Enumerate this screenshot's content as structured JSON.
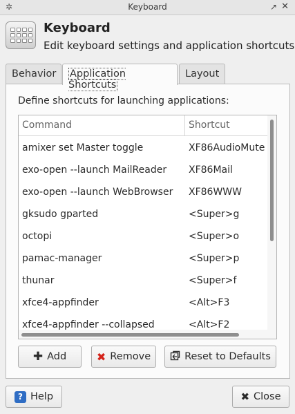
{
  "window": {
    "title": "Keyboard",
    "menu_icon": "✲",
    "maximize_icon": "↗",
    "close_icon": "✕"
  },
  "header": {
    "title": "Keyboard",
    "subtitle": "Edit keyboard settings and application shortcuts",
    "icon": "keyboard-icon"
  },
  "tabs": [
    {
      "label": "Behavior",
      "active": false
    },
    {
      "label": "Application Shortcuts",
      "active": true
    },
    {
      "label": "Layout",
      "active": false
    }
  ],
  "shortcuts": {
    "instruction": "Define shortcuts for launching applications:",
    "columns": {
      "command": "Command",
      "shortcut": "Shortcut"
    },
    "rows": [
      {
        "command": "amixer set Master toggle",
        "shortcut": "XF86AudioMute"
      },
      {
        "command": "exo-open --launch MailReader",
        "shortcut": "XF86Mail"
      },
      {
        "command": "exo-open --launch WebBrowser",
        "shortcut": "XF86WWW"
      },
      {
        "command": "gksudo gparted",
        "shortcut": "<Super>g"
      },
      {
        "command": "octopi",
        "shortcut": "<Super>o"
      },
      {
        "command": "pamac-manager",
        "shortcut": "<Super>p"
      },
      {
        "command": "thunar",
        "shortcut": "<Super>f"
      },
      {
        "command": "xfce4-appfinder",
        "shortcut": "<Alt>F3"
      },
      {
        "command": "xfce4-appfinder --collapsed",
        "shortcut": "<Alt>F2"
      }
    ]
  },
  "buttons": {
    "add": "Add",
    "remove": "Remove",
    "reset": "Reset to Defaults",
    "help": "Help",
    "close": "Close"
  },
  "colors": {
    "accent_remove": "#d4231a",
    "help_icon": "#2f6dc4"
  }
}
